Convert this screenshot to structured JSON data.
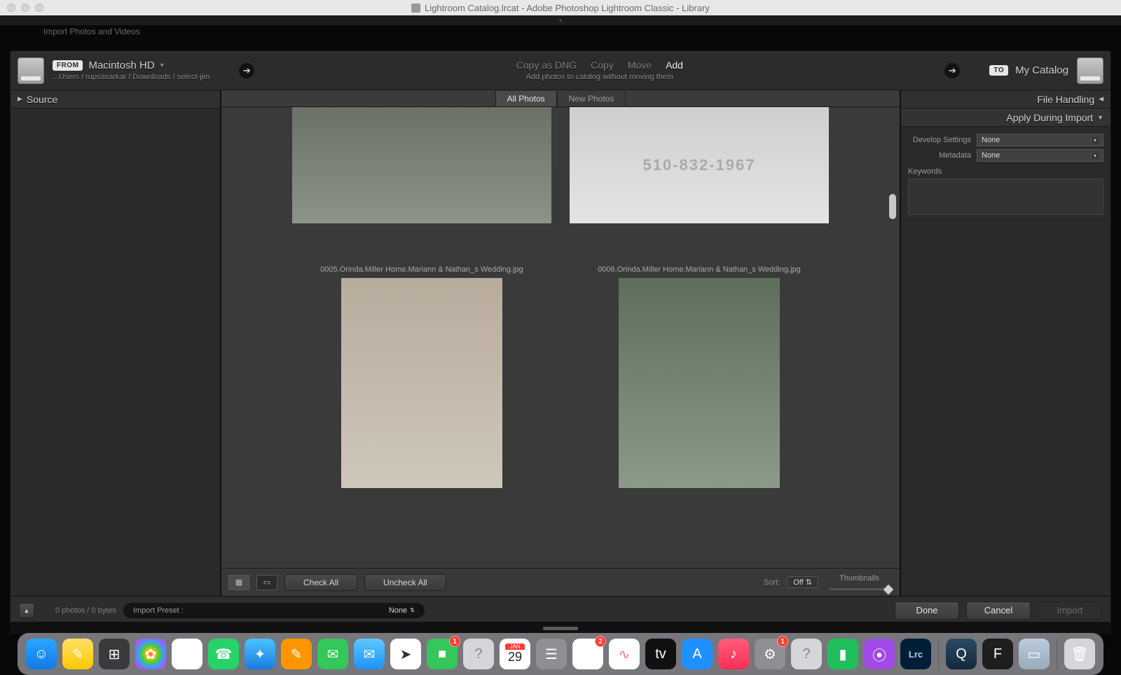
{
  "window": {
    "title": "Lightroom Catalog.lrcat - Adobe Photoshop Lightroom Classic - Library"
  },
  "hint": "Import Photos and Videos",
  "from": {
    "pill": "FROM",
    "device": "Macintosh HD",
    "path": "...Users / rupsasarkar / Downloads / select-jim"
  },
  "to": {
    "pill": "TO",
    "device": "My Catalog"
  },
  "method": {
    "options": [
      "Copy as DNG",
      "Copy",
      "Move",
      "Add"
    ],
    "active": "Add",
    "subtitle": "Add photos to catalog without moving them"
  },
  "leftPanel": {
    "title": "Source"
  },
  "centerTabs": {
    "all": "All Photos",
    "new": "New Photos",
    "active": "all"
  },
  "thumbs": {
    "row2": [
      "0005.Orinda.Miller Home.Mariann & Nathan_s Wedding.jpg",
      "0006.Orinda.Miller Home.Mariann & Nathan_s Wedding.jpg"
    ],
    "ph2_phone": "510-832-1967"
  },
  "centerFoot": {
    "checkAll": "Check All",
    "uncheckAll": "Uncheck All",
    "sortLabel": "Sort:",
    "sortValue": "Off",
    "thumbLabel": "Thumbnails"
  },
  "rightPanels": {
    "fileHandling": "File Handling",
    "applyDuring": "Apply During Import",
    "develop": {
      "label": "Develop Settings",
      "value": "None"
    },
    "metadata": {
      "label": "Metadata",
      "value": "None"
    },
    "keywords": "Keywords"
  },
  "dlgFoot": {
    "status": "0 photos / 0 bytes",
    "presetLabel": "Import Preset :",
    "presetValue": "None",
    "done": "Done",
    "cancel": "Cancel",
    "import": "Import"
  },
  "dock": {
    "calendar": {
      "month": "JAN",
      "day": "29"
    },
    "reminders_badge": "2",
    "facetime_badge": "1",
    "settings_badge": "1",
    "lrc": "Lrc"
  }
}
